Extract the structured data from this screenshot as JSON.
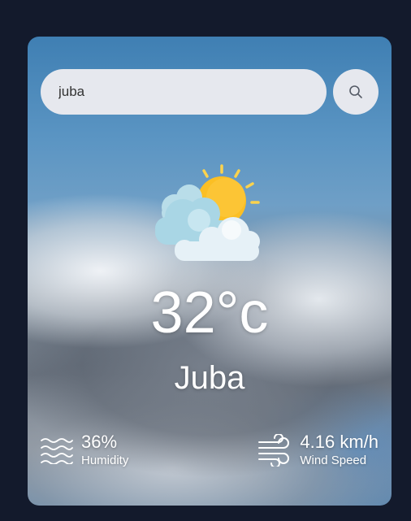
{
  "search": {
    "value": "juba",
    "button_icon": "search-icon"
  },
  "weather": {
    "icon": "partly-cloudy-icon",
    "temperature": "32°c",
    "city": "Juba"
  },
  "humidity": {
    "icon": "humidity-waves-icon",
    "value": "36%",
    "label": "Humidity"
  },
  "wind": {
    "icon": "wind-icon",
    "value": "4.16 km/h",
    "label": "Wind Speed"
  },
  "colors": {
    "page_background": "#131a2c",
    "input_background": "#e6e8ee",
    "text": "#ffffff",
    "sun": "#fbbf24"
  }
}
